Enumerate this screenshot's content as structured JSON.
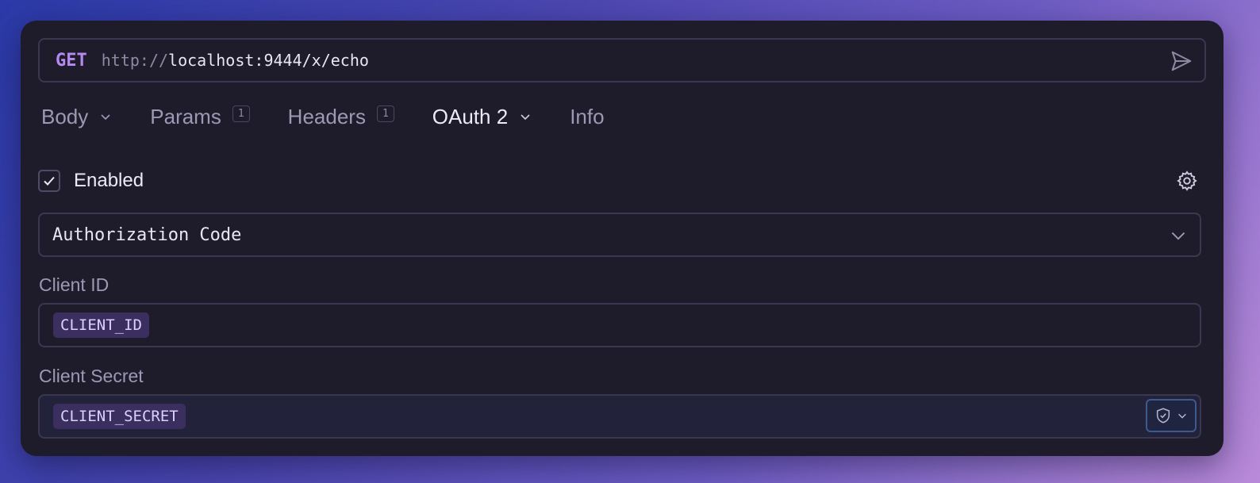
{
  "request": {
    "method": "GET",
    "url_scheme": "http://",
    "url_rest": "localhost:9444/x/echo",
    "send_icon": "send-icon"
  },
  "tabs": [
    {
      "label": "Body",
      "has_dropdown": true
    },
    {
      "label": "Params",
      "count": "1"
    },
    {
      "label": "Headers",
      "count": "1"
    },
    {
      "label": "OAuth 2",
      "has_dropdown": true,
      "active": true
    },
    {
      "label": "Info"
    }
  ],
  "auth": {
    "enabled_label": "Enabled",
    "enabled": true,
    "grant_type": "Authorization Code",
    "client_id_label": "Client ID",
    "client_id_value": "CLIENT_ID",
    "client_secret_label": "Client Secret",
    "client_secret_value": "CLIENT_SECRET"
  },
  "colors": {
    "method": "#b58af0",
    "panel": "#1e1c2b",
    "chip_bg": "#3a2f5f",
    "chip_text": "#ddd0ff"
  }
}
